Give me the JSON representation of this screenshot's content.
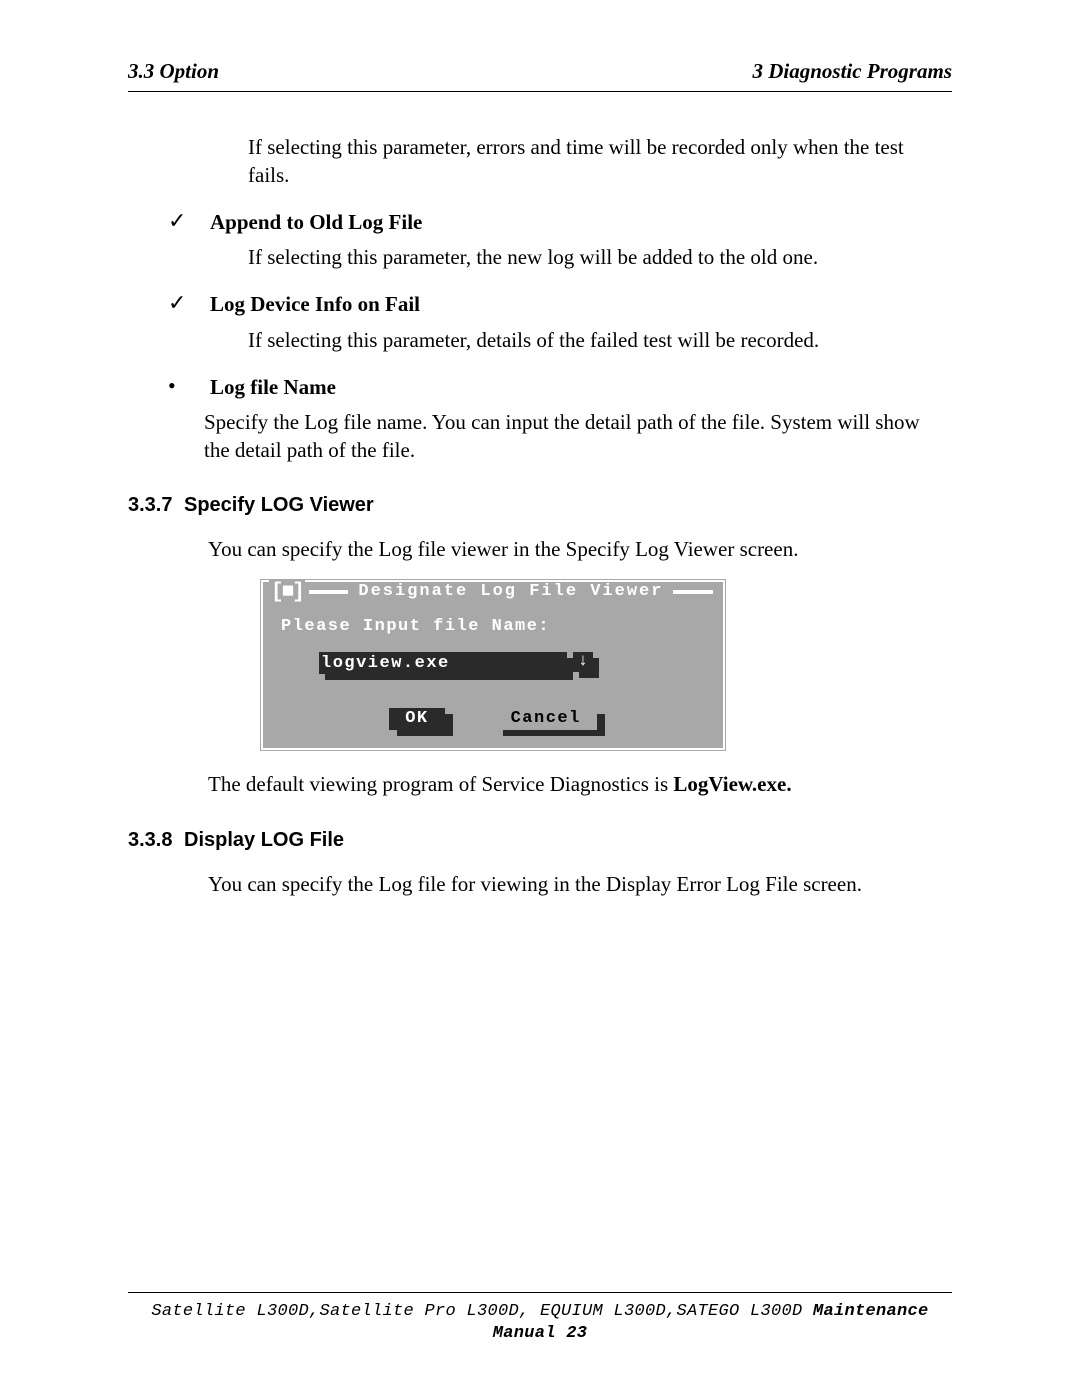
{
  "header": {
    "left": "3.3 Option",
    "right": "3  Diagnostic Programs"
  },
  "intro_para": "If selecting this parameter, errors and time will be recorded only when the test fails.",
  "items": [
    {
      "marker": "check",
      "title": "Append to Old Log File",
      "body": "If selecting this parameter, the new log will be added to the old one."
    },
    {
      "marker": "check",
      "title": "Log Device Info on Fail",
      "body": "If selecting this parameter, details of the failed test will be recorded."
    },
    {
      "marker": "bullet",
      "title": "Log file Name",
      "body": "Specify the Log file name. You can input the detail path of the file. System will show the detail path of the file."
    }
  ],
  "sec337": {
    "num": "3.3.7",
    "title": "Specify LOG Viewer",
    "para": "You can specify the Log file viewer in the Specify Log Viewer screen.",
    "closing_pre": "The default viewing program of Service Diagnostics is ",
    "closing_bold": "LogView.exe."
  },
  "dialog": {
    "control": "[■]",
    "title": "Designate Log File Viewer",
    "prompt": "Please Input file Name:",
    "input_value": "logview.exe",
    "drop_glyph": "↓",
    "ok": "OK",
    "cancel": "Cancel"
  },
  "sec338": {
    "num": "3.3.8",
    "title": "Display LOG File",
    "para": "You can specify the Log file for viewing in the Display Error Log File screen."
  },
  "footer": {
    "models": "Satellite L300D,Satellite Pro L300D, EQUIUM L300D,SATEGO L300D",
    "suffix": " Maintenance Manual 23"
  }
}
